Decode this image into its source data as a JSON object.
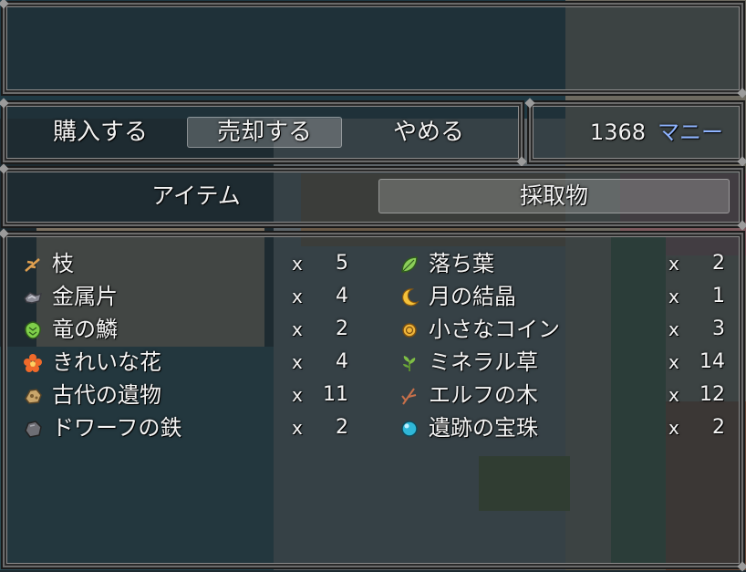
{
  "command": {
    "items": [
      "購入する",
      "売却する",
      "やめる"
    ],
    "selected_index": 1
  },
  "gold": {
    "amount": "1368",
    "unit": "マニー",
    "unit_color": "#8fb4ff"
  },
  "categories": {
    "items": [
      "アイテム",
      "採取物"
    ],
    "selected_index": 1
  },
  "items": {
    "left": [
      {
        "name": "枝",
        "mult": "x",
        "qty": "5",
        "icon": "twig-icon"
      },
      {
        "name": "金属片",
        "mult": "x",
        "qty": "4",
        "icon": "metal-shard-icon"
      },
      {
        "name": "竜の鱗",
        "mult": "x",
        "qty": "2",
        "icon": "dragon-scale-icon"
      },
      {
        "name": "きれいな花",
        "mult": "x",
        "qty": "4",
        "icon": "flower-icon"
      },
      {
        "name": "古代の遺物",
        "mult": "x",
        "qty": "11",
        "icon": "relic-icon"
      },
      {
        "name": "ドワーフの鉄",
        "mult": "x",
        "qty": "2",
        "icon": "iron-ore-icon"
      }
    ],
    "right": [
      {
        "name": "落ち葉",
        "mult": "x",
        "qty": "2",
        "icon": "leaf-icon"
      },
      {
        "name": "月の結晶",
        "mult": "x",
        "qty": "1",
        "icon": "moon-crystal-icon"
      },
      {
        "name": "小さなコイン",
        "mult": "x",
        "qty": "3",
        "icon": "coin-icon"
      },
      {
        "name": "ミネラル草",
        "mult": "x",
        "qty": "14",
        "icon": "herb-icon"
      },
      {
        "name": "エルフの木",
        "mult": "x",
        "qty": "12",
        "icon": "branch-icon"
      },
      {
        "name": "遺跡の宝珠",
        "mult": "x",
        "qty": "2",
        "icon": "orb-icon"
      }
    ]
  }
}
